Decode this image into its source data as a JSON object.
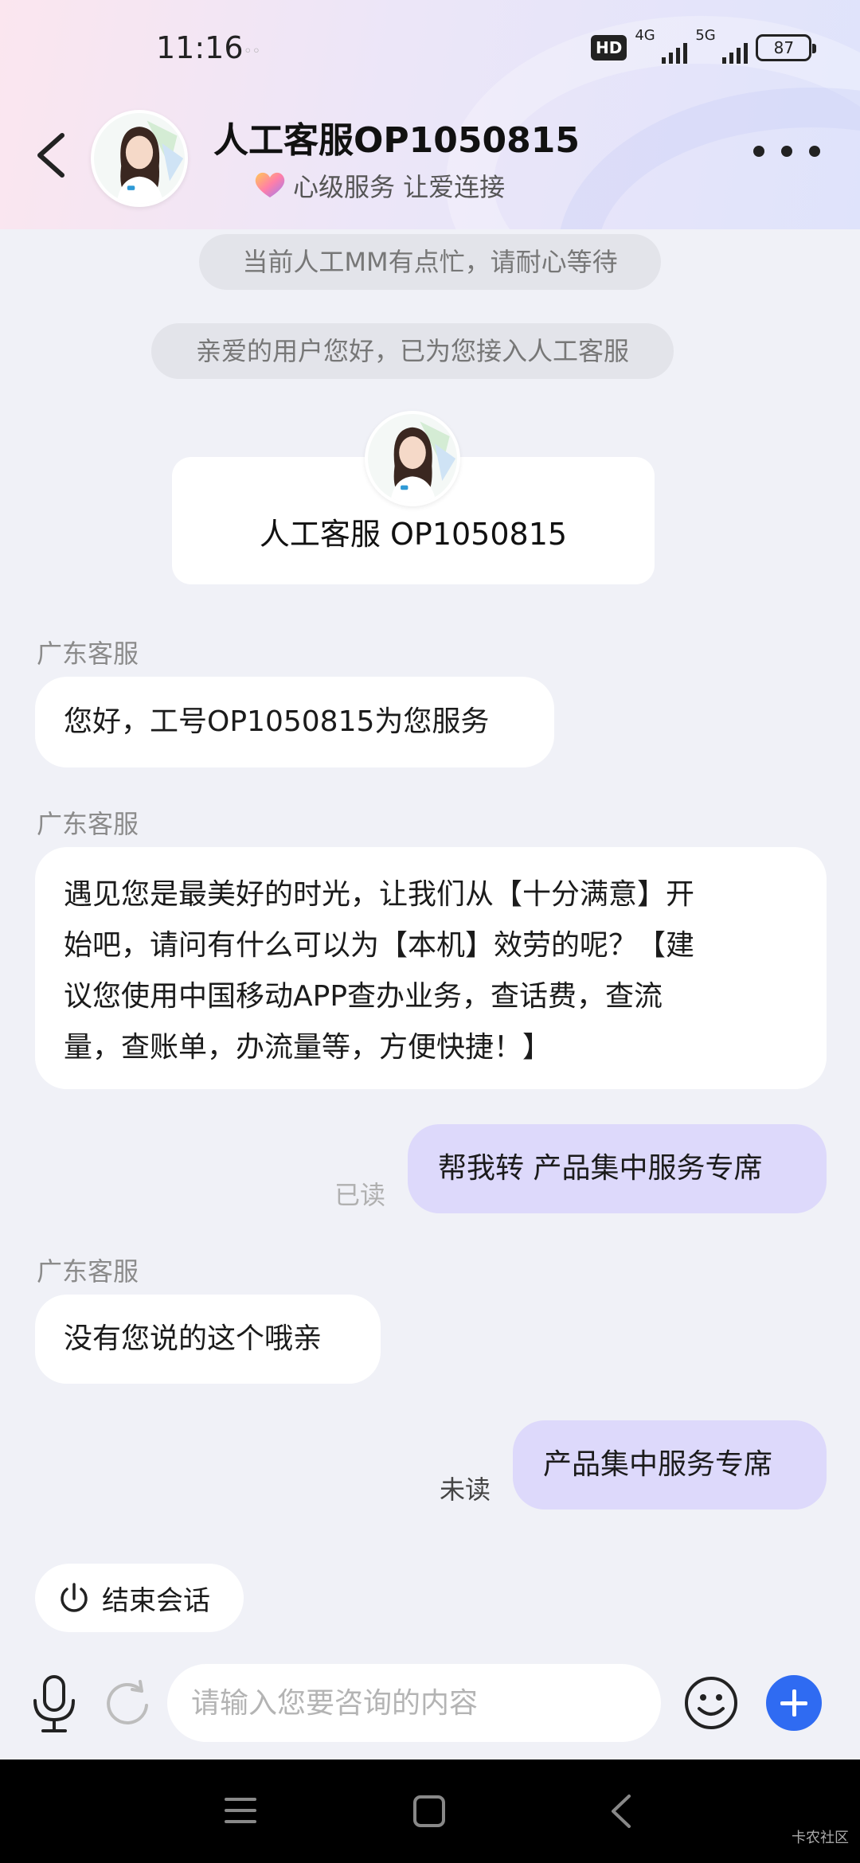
{
  "status_bar": {
    "time": "11:16",
    "hd_badge": "HD",
    "network_1": "4G",
    "network_2": "5G",
    "battery": "87"
  },
  "header": {
    "agent_name": "人工客服OP1050815",
    "slogan": "心级服务 让爱连接"
  },
  "chat": {
    "system_notice_busy": "当前人工MM有点忙，请耐心等待",
    "system_notice_connected": "亲爱的用户您好，已为您接入人工客服",
    "agent_card_title": "人工客服 OP1050815",
    "messages": [
      {
        "sender": "广东客服",
        "text": "您好，工号OP1050815为您服务"
      },
      {
        "sender": "广东客服",
        "lines": [
          "遇见您是最美好的时光，让我们从【十分满意】开",
          "始吧，请问有什么可以为【本机】效劳的呢？【建",
          "议您使用中国移动APP查办业务，查话费，查流",
          "量，查账单，办流量等，方便快捷！】"
        ]
      },
      {
        "text": "帮我转 产品集中服务专席",
        "status": "已读"
      },
      {
        "sender": "广东客服",
        "text": "没有您说的这个哦亲"
      },
      {
        "text": "产品集中服务专席",
        "status": "未读"
      }
    ],
    "end_session_label": "结束会话"
  },
  "input": {
    "placeholder": "请输入您要咨询的内容"
  },
  "icons": {
    "back": "chevron-left-icon",
    "more": "more-dots-icon",
    "mic": "microphone-icon",
    "refresh": "refresh-icon",
    "emoji": "smiley-icon",
    "add": "plus-icon",
    "power": "power-icon"
  },
  "colors": {
    "outgoing_bubble": "#ddd9fb",
    "accent": "#2f6bf2"
  },
  "watermark": "卡农社区"
}
